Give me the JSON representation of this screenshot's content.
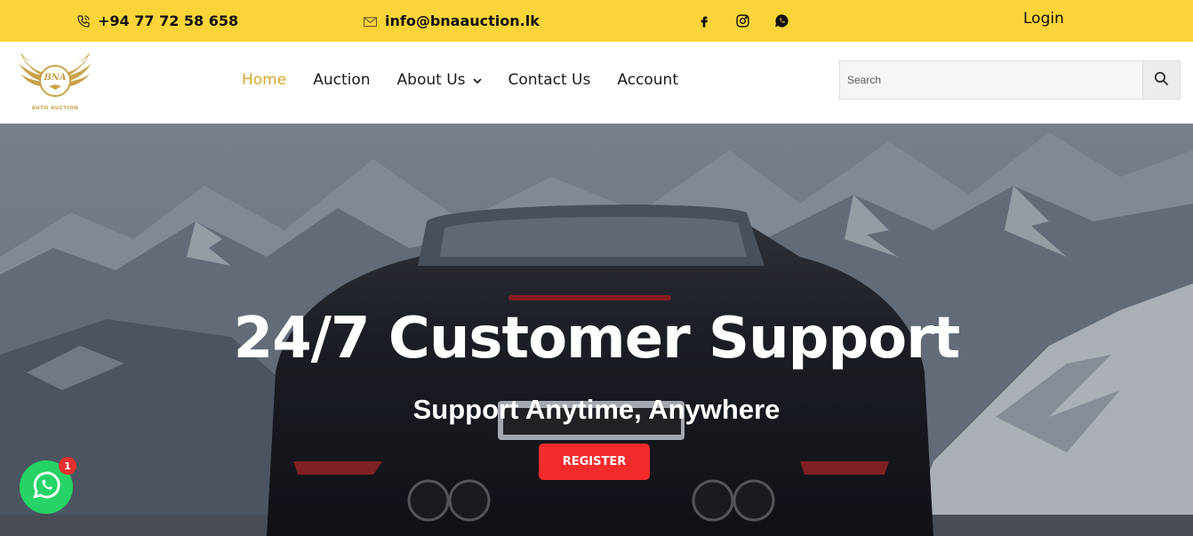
{
  "topbar": {
    "phone": "+94 77 72 58 658",
    "email": "info@bnaauction.lk",
    "social_icons": [
      "facebook-icon",
      "instagram-icon",
      "whatsapp-icon"
    ],
    "login": "Login"
  },
  "header": {
    "logo_text": "BNA",
    "logo_subtext": "AUTO AUCTION",
    "nav": [
      {
        "label": "Home",
        "active": true
      },
      {
        "label": "Auction"
      },
      {
        "label": "About Us",
        "dropdown": true
      },
      {
        "label": "Contact Us"
      },
      {
        "label": "Account"
      }
    ],
    "search": {
      "placeholder": "Search"
    }
  },
  "hero": {
    "title": "24/7 Customer Support",
    "subtitle": "Support Anytime, Anywhere",
    "cta": "REGISTER"
  },
  "whatsapp_widget": {
    "badge_count": "1"
  },
  "colors": {
    "topbar": "#fbd43a",
    "accent": "#d4a82a",
    "cta": "#f32b2b",
    "whatsapp": "#25d366"
  }
}
